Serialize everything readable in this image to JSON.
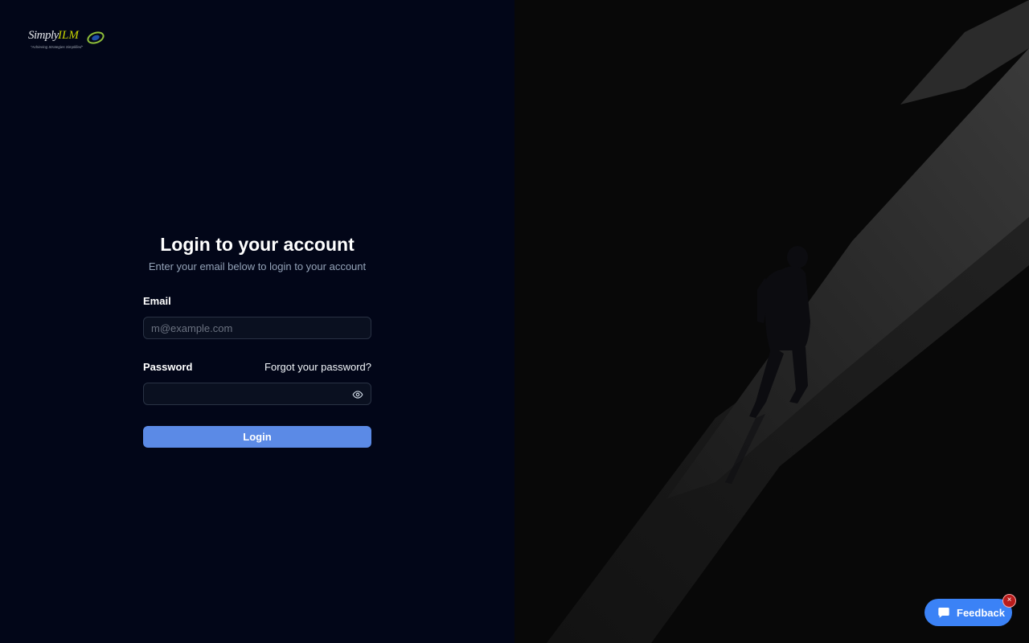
{
  "logo": {
    "brand_part1": "Simply",
    "brand_part2": "ILM",
    "tagline": "\"Achieving Strategies Simplified\""
  },
  "form": {
    "title": "Login to your account",
    "subtitle": "Enter your email below to login to your account",
    "email_label": "Email",
    "email_placeholder": "m@example.com",
    "email_value": "",
    "password_label": "Password",
    "forgot_link": "Forgot your password?",
    "password_value": "",
    "login_button": "Login"
  },
  "feedback": {
    "label": "Feedback",
    "close": "×"
  },
  "colors": {
    "background": "#020618",
    "accent": "#5b8ae6",
    "feedback": "#3b82f6",
    "logo_green": "#c8d400"
  },
  "icons": [
    "eye-icon",
    "chat-icon",
    "close-icon",
    "logo-swirl-icon"
  ]
}
